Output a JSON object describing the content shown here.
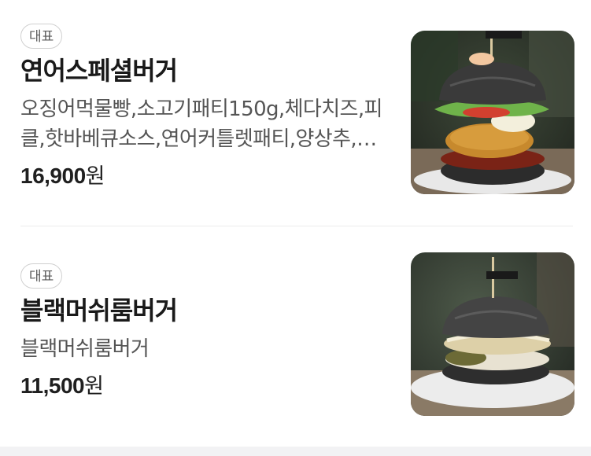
{
  "menu_items": [
    {
      "badge": "대표",
      "name": "연어스페셜버거",
      "description": "오징어먹물빵,소고기패티150g,체다치즈,피클,핫바베큐소스,연어커틀렛패티,양상추,토마토,새우",
      "price": "16,900",
      "currency": "원"
    },
    {
      "badge": "대표",
      "name": "블랙머쉬룸버거",
      "description": "블랙머쉬룸버거",
      "price": "11,500",
      "currency": "원"
    }
  ],
  "colors": {
    "badge_border": "#d0d0d0",
    "divider": "#ececec",
    "bottom_bar": "#f2f2f4"
  }
}
